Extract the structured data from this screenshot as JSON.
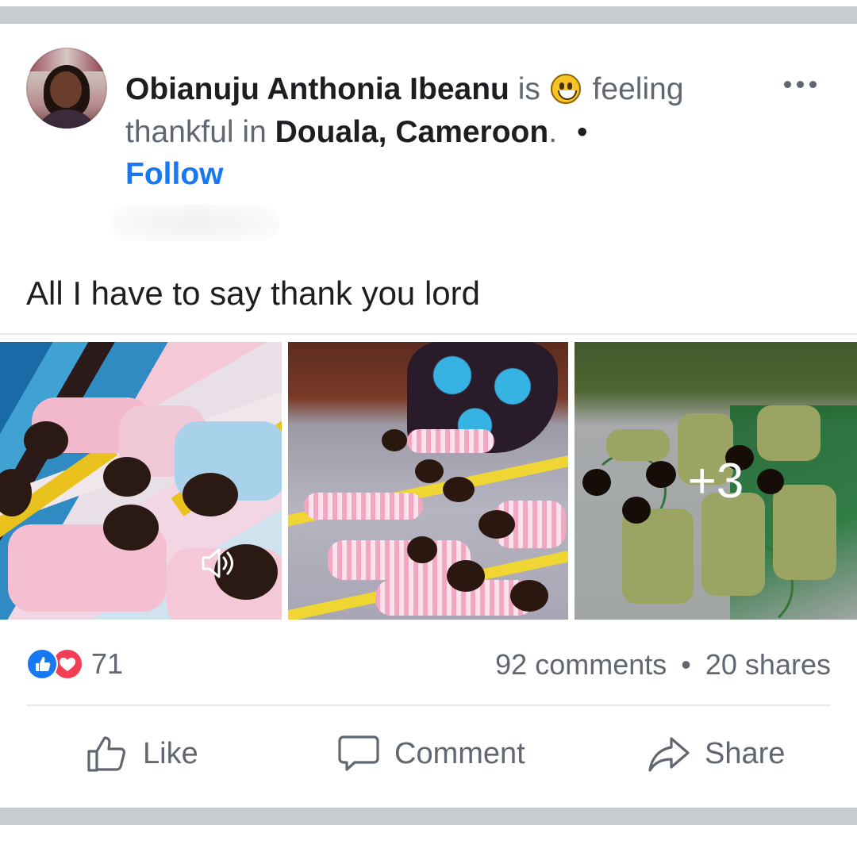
{
  "post": {
    "author": "Obianuju Anthonia Ibeanu",
    "is_text": "is",
    "feeling_text": "feeling thankful in",
    "location": "Douala, Cameroon",
    "location_suffix": ".",
    "separator_dot": "•",
    "follow_label": "Follow",
    "feeling_icon": "grinning-face-emoji",
    "more_icon": "more-options-icon",
    "text": "All I have to say thank you lord"
  },
  "photos": {
    "more_count_label": "+3",
    "video_icon": "speaker-icon"
  },
  "stats": {
    "reaction_count": "71",
    "reaction_icons": [
      "like-reaction-icon",
      "love-reaction-icon"
    ],
    "comments": "92 comments",
    "dot": "•",
    "shares": "20 shares"
  },
  "actions": {
    "like_label": "Like",
    "comment_label": "Comment",
    "share_label": "Share"
  },
  "colors": {
    "link_blue": "#1877f2",
    "secondary_text": "#606770",
    "love_red": "#f33e58",
    "separator_gray": "#c9ccd1"
  }
}
